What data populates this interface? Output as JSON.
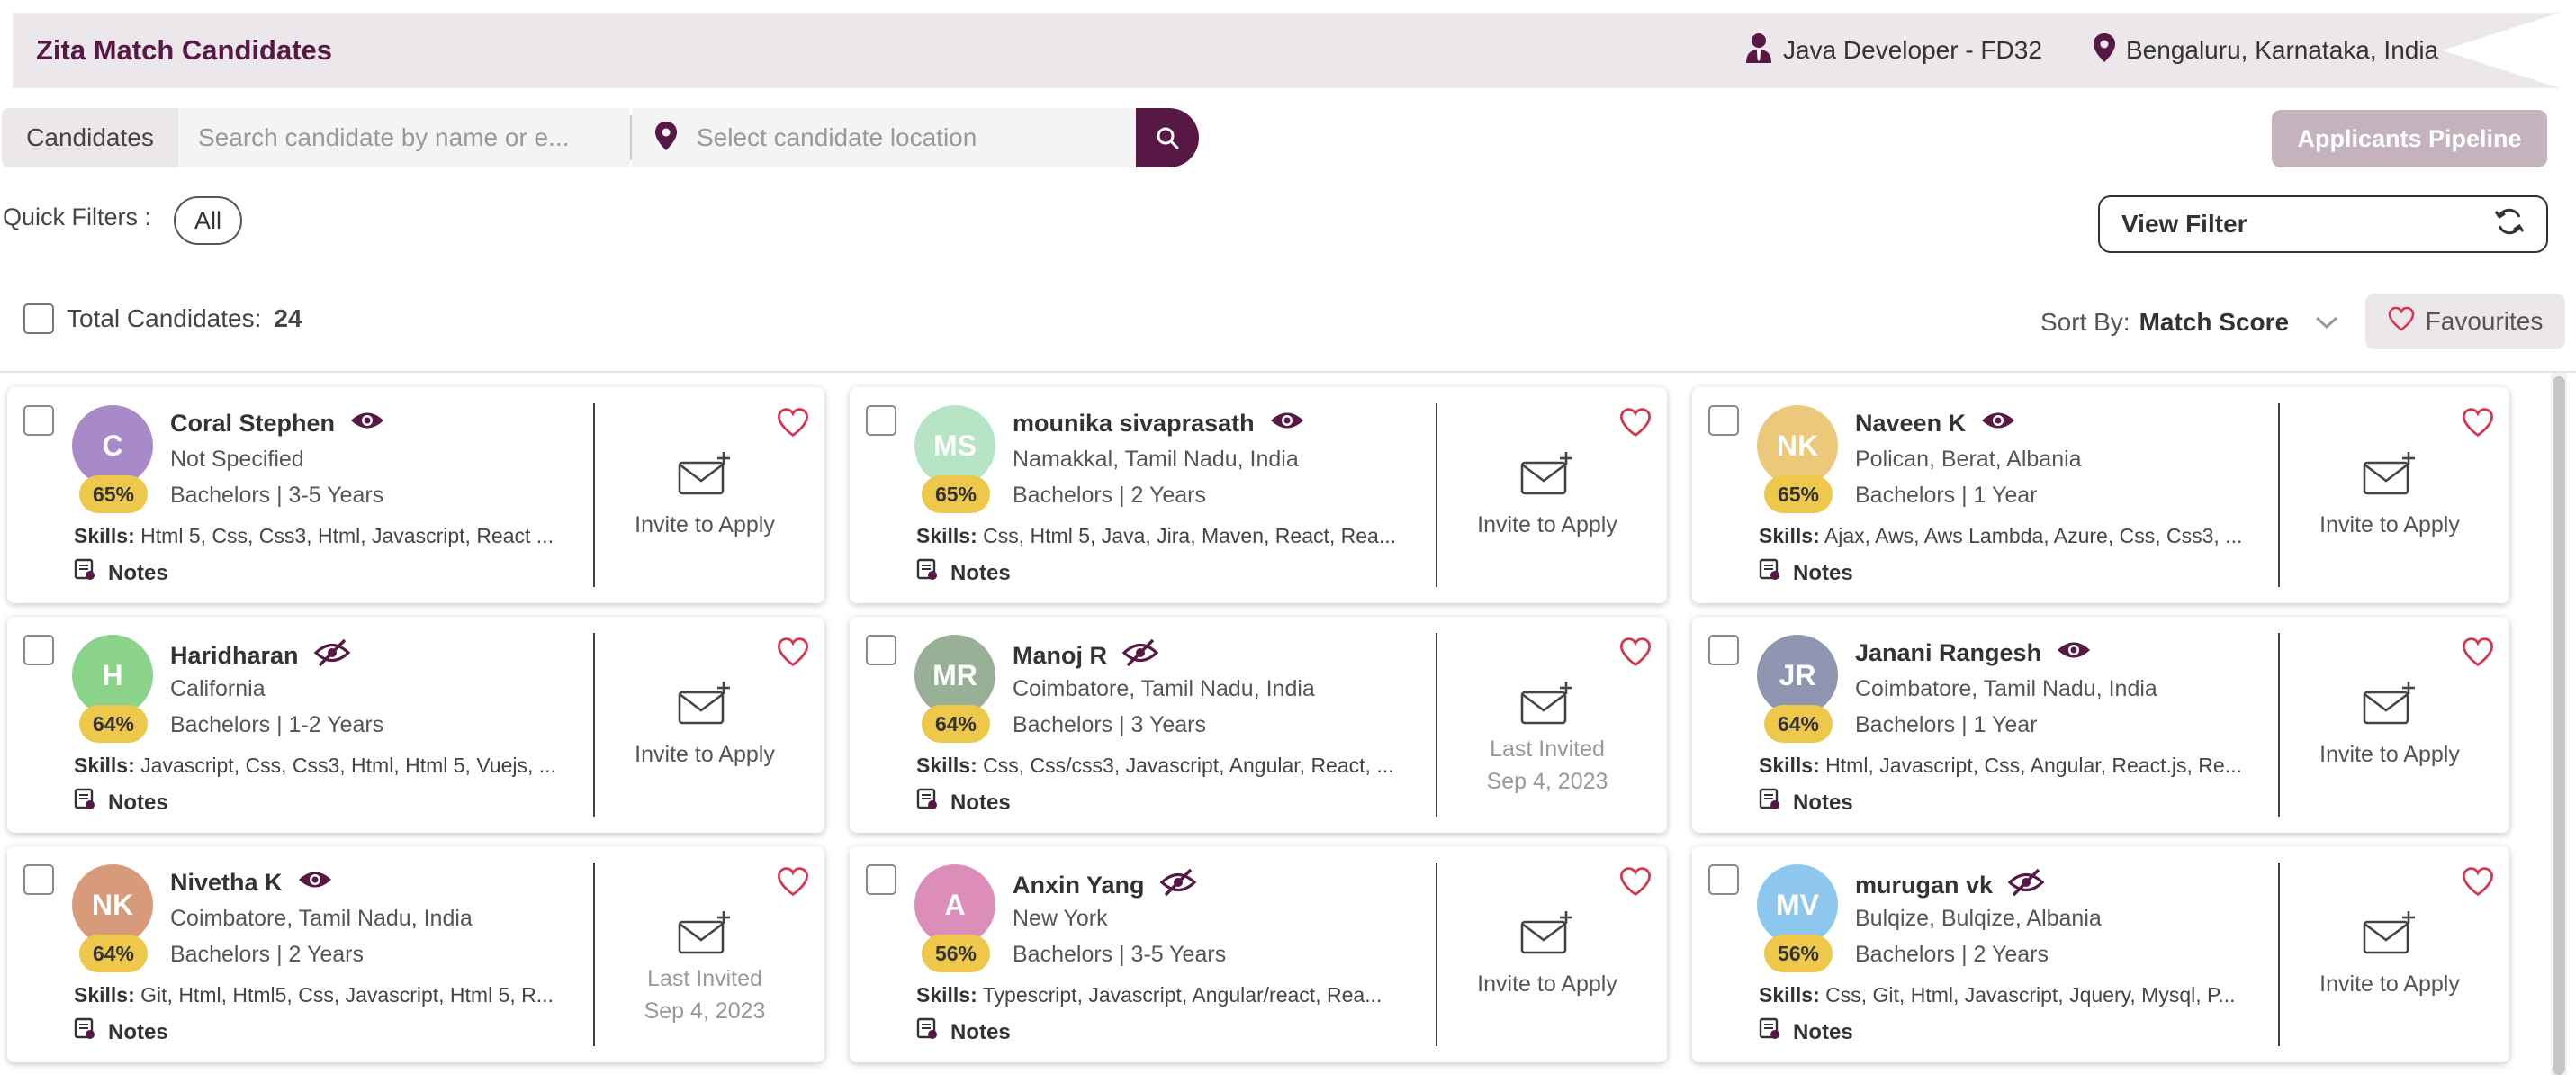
{
  "header": {
    "title": "Zita Match Candidates",
    "job": "Java Developer - FD32",
    "location": "Bengaluru, Karnataka, India"
  },
  "search": {
    "tab_label": "Candidates",
    "name_placeholder": "Search candidate by name or e...",
    "location_placeholder": "Select candidate location"
  },
  "pipeline_button": "Applicants Pipeline",
  "quick_filters": {
    "label": "Quick Filters :",
    "chip": "All"
  },
  "view_filter": "View Filter",
  "total": {
    "label": "Total Candidates:",
    "count": "24"
  },
  "sort": {
    "label": "Sort By:",
    "value": "Match Score"
  },
  "favourites": "Favourites",
  "labels": {
    "skills": "Skills:",
    "notes": "Notes",
    "invite": "Invite to Apply",
    "last_invited": "Last Invited"
  },
  "colors": {
    "brand": "#581845",
    "score": "#eec84a",
    "heart": "#d9324a"
  },
  "candidates": [
    {
      "initials": "C",
      "avatar_color": "#a98ac9",
      "name": "Coral Stephen",
      "visible": true,
      "score": "65%",
      "location": "Not Specified",
      "education": "Bachelors | 3-5 Years",
      "skills": "Html 5, Css, Css3, Html, Javascript, React ...",
      "invited": false,
      "invite_date": ""
    },
    {
      "initials": "MS",
      "avatar_color": "#b8e4c6",
      "name": "mounika sivaprasath",
      "visible": true,
      "score": "65%",
      "location": "Namakkal, Tamil Nadu, India",
      "education": "Bachelors | 2 Years",
      "skills": "Css, Html 5, Java, Jira, Maven, React, Rea...",
      "invited": false,
      "invite_date": ""
    },
    {
      "initials": "NK",
      "avatar_color": "#ebc87a",
      "name": "Naveen K",
      "visible": true,
      "score": "65%",
      "location": "Polican, Berat, Albania",
      "education": "Bachelors | 1 Year",
      "skills": "Ajax, Aws, Aws Lambda, Azure, Css, Css3, ...",
      "invited": false,
      "invite_date": ""
    },
    {
      "initials": "H",
      "avatar_color": "#8bd38a",
      "name": "Haridharan",
      "visible": false,
      "score": "64%",
      "location": "California",
      "education": "Bachelors | 1-2 Years",
      "skills": "Javascript, Css, Css3, Html, Html 5, Vuejs, ...",
      "invited": false,
      "invite_date": ""
    },
    {
      "initials": "MR",
      "avatar_color": "#98b096",
      "name": "Manoj R",
      "visible": false,
      "score": "64%",
      "location": "Coimbatore, Tamil Nadu, India",
      "education": "Bachelors | 3 Years",
      "skills": "Css, Css/css3, Javascript, Angular, React, ...",
      "invited": true,
      "invite_date": "Sep 4, 2023"
    },
    {
      "initials": "JR",
      "avatar_color": "#8e95b1",
      "name": "Janani Rangesh",
      "visible": true,
      "score": "64%",
      "location": "Coimbatore, Tamil Nadu, India",
      "education": "Bachelors | 1 Year",
      "skills": "Html, Javascript, Css, Angular, React.js, Re...",
      "invited": false,
      "invite_date": ""
    },
    {
      "initials": "NK",
      "avatar_color": "#d79b7c",
      "name": "Nivetha K",
      "visible": true,
      "score": "64%",
      "location": "Coimbatore, Tamil Nadu, India",
      "education": "Bachelors | 2 Years",
      "skills": "Git, Html, Html5, Css, Javascript, Html 5, R...",
      "invited": true,
      "invite_date": "Sep 4, 2023"
    },
    {
      "initials": "A",
      "avatar_color": "#dc8dba",
      "name": "Anxin Yang",
      "visible": false,
      "score": "56%",
      "location": "New York",
      "education": "Bachelors | 3-5 Years",
      "skills": "Typescript, Javascript, Angular/react, Rea...",
      "invited": false,
      "invite_date": ""
    },
    {
      "initials": "MV",
      "avatar_color": "#8ec7ee",
      "name": "murugan vk",
      "visible": false,
      "score": "56%",
      "location": "Bulqize, Bulqize, Albania",
      "education": "Bachelors | 2 Years",
      "skills": "Css, Git, Html, Javascript, Jquery, Mysql, P...",
      "invited": false,
      "invite_date": ""
    }
  ]
}
